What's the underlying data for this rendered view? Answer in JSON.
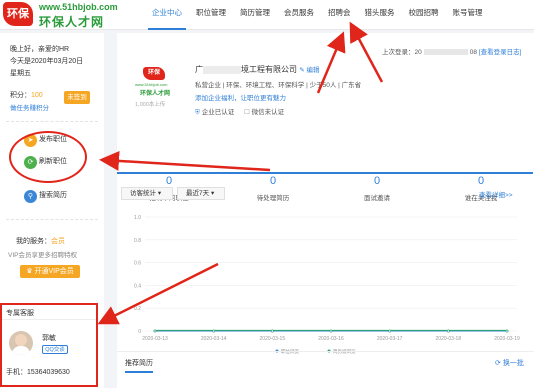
{
  "logo": {
    "badge": "环保",
    "url": "www.51hbjob.com",
    "name": "环保人才网"
  },
  "nav": {
    "items": [
      "企业中心",
      "职位管理",
      "简历管理",
      "会员服务",
      "招聘会",
      "猎头服务",
      "校园招聘",
      "账号管理"
    ]
  },
  "sidebar": {
    "greeting": "晚上好，亲爱的HR",
    "date": "今天是2020年03月20日",
    "weekday": "星期五",
    "points_label": "积分：",
    "points_value": "100",
    "task_link": "做任务赚积分",
    "checkin": "未签到",
    "actions": [
      {
        "label": "发布职位"
      },
      {
        "label": "刷新职位"
      },
      {
        "label": "搜索简历"
      }
    ],
    "service_label": "我的服务：",
    "service_value": "会员",
    "vip_note": "VIP会员享更多招聘特权",
    "vip_button": "开通VIP会员",
    "consultant_title": "专属客服",
    "consultant_name": "郭敏",
    "consultant_tag": "QQ交谈",
    "phone": "手机：15364039630"
  },
  "company": {
    "last_login_label": "上次登录：20",
    "last_login_suffix": "08",
    "login_log": "[查看登录日志]",
    "name": "广",
    "name_suffix": "境工程有限公司",
    "edit": "编辑",
    "meta": "私营企业 | 环保、环境工程、环保科学 | 少于50人 | 广东省",
    "benefits": "添加企业福利，让职位更有魅力",
    "verified": "企业已认证",
    "wechat": "微信未认证",
    "logo_url": "www.51hbjob.com",
    "logo_name": "环保人才网",
    "logo_hint": "1,000本上传"
  },
  "stats": [
    {
      "value": "0",
      "label": "招聘中的职位"
    },
    {
      "value": "0",
      "label": "待处理简历"
    },
    {
      "value": "0",
      "label": "面试邀请"
    },
    {
      "value": "0",
      "label": "谁在关注我"
    }
  ],
  "chart_panel": {
    "select1": "访客统计",
    "select2": "最近7天",
    "more": "查看详细>>"
  },
  "chart_data": {
    "type": "line",
    "x": [
      "2020-03-13",
      "2020-03-14",
      "2020-03-15",
      "2020-03-16",
      "2020-03-17",
      "2020-03-18",
      "2020-03-19"
    ],
    "series": [
      {
        "name": "职位浏览",
        "values": [
          0,
          0,
          0,
          0,
          0,
          0,
          0
        ]
      },
      {
        "name": "简历被浏览",
        "values": [
          0,
          0,
          0,
          0,
          0,
          0,
          0
        ]
      }
    ],
    "y_ticks": [
      "1.0",
      "0.8",
      "0.6",
      "0.4",
      "0.2",
      "0"
    ],
    "ylim": [
      0,
      1
    ],
    "colors": [
      "#3b86d6",
      "#2aa36b"
    ]
  },
  "recommend": {
    "tab": "推荐简历",
    "refresh": "换一批"
  },
  "colors": {
    "accent": "#2f7fd8",
    "orange": "#f5a623",
    "red": "#e0261b",
    "green": "#2a9b3a"
  }
}
